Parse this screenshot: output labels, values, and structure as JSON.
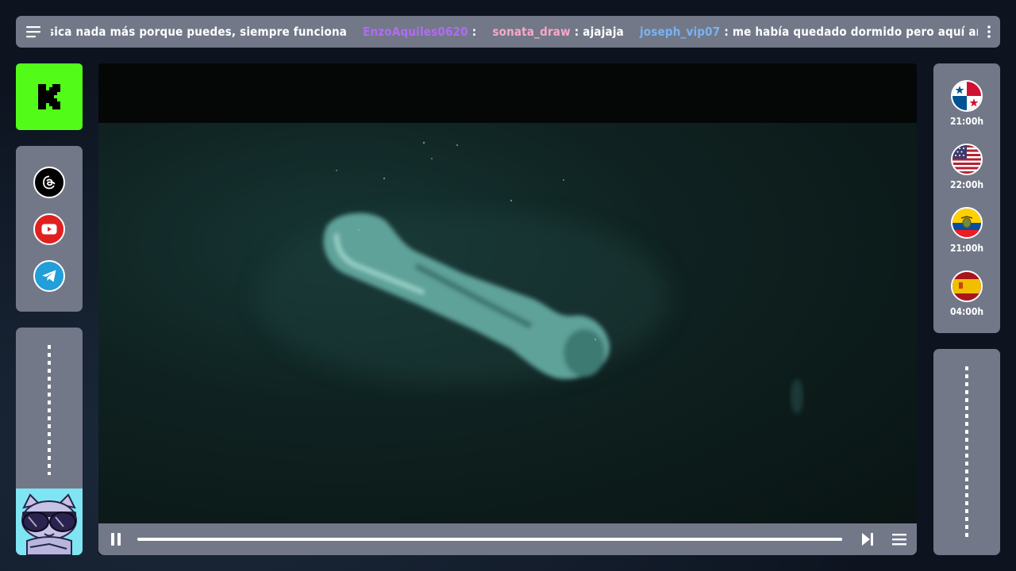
{
  "ticker": {
    "messages": [
      {
        "user": "",
        "text": "sica nada más porque puedes, siempre funciona",
        "color": "#ffffff"
      },
      {
        "user": "EnzoAquiles0620",
        "text": ":",
        "color": "#b06cf2"
      },
      {
        "user": "sonata_draw",
        "text": ": ajajaja",
        "color": "#f7a8c8"
      },
      {
        "user": "joseph_vip07",
        "text": ": me había quedado dormido pero aquí ando",
        "color": "#7ab3f2"
      }
    ],
    "menu_icon": "hamburger-icon",
    "more_icon": "kebab-menu-icon"
  },
  "logo": {
    "brand": "kick",
    "letter": "K",
    "color": "#53fc18"
  },
  "socials": [
    {
      "name": "threads",
      "color": "#000000"
    },
    {
      "name": "youtube",
      "color": "#e21f1f"
    },
    {
      "name": "telegram",
      "color": "#229ed9"
    }
  ],
  "schedule": [
    {
      "country": "Panama",
      "time": "21:00h"
    },
    {
      "country": "USA",
      "time": "22:00h"
    },
    {
      "country": "Ecuador",
      "time": "21:00h"
    },
    {
      "country": "Spain",
      "time": "04:00h"
    }
  ],
  "player": {
    "state": "playing",
    "progress": 1.0,
    "play_pause_icon": "pause-icon",
    "next_icon": "skip-next-icon",
    "playlist_icon": "playlist-icon"
  }
}
